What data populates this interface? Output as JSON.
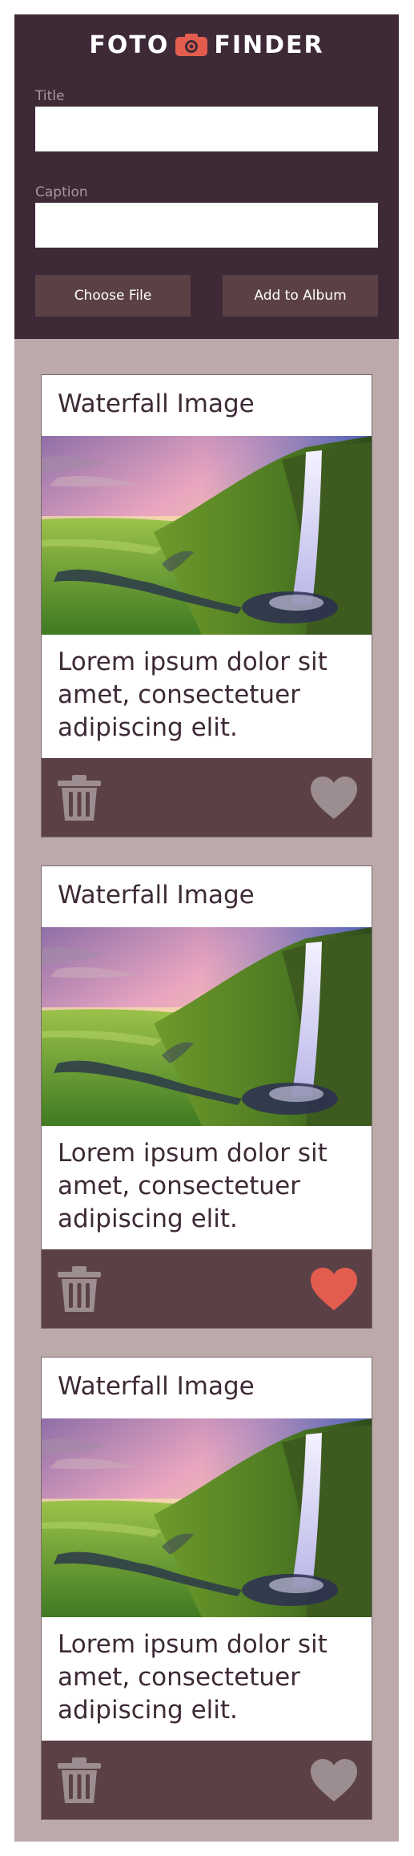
{
  "header": {
    "logo_left": "FOTO",
    "logo_right": "FINDER",
    "logo_icon": "camera-icon",
    "title_label": "Title",
    "title_value": "",
    "caption_label": "Caption",
    "caption_value": "",
    "choose_file_label": "Choose File",
    "add_album_label": "Add to Album"
  },
  "colors": {
    "header_bg": "#3d2a36",
    "page_bg": "#bcaaab",
    "button_bg": "#5b4146",
    "accent": "#e35d4f",
    "icon_muted": "#9c8d91"
  },
  "cards": [
    {
      "title": "Waterfall Image",
      "caption": "Lorem ipsum dolor sit amet, consectetuer adipiscing elit.",
      "favorited": false
    },
    {
      "title": "Waterfall Image",
      "caption": "Lorem ipsum dolor sit amet, consectetuer adipiscing elit.",
      "favorited": true
    },
    {
      "title": "Waterfall Image",
      "caption": "Lorem ipsum dolor sit amet, consectetuer adipiscing elit.",
      "favorited": false
    }
  ]
}
